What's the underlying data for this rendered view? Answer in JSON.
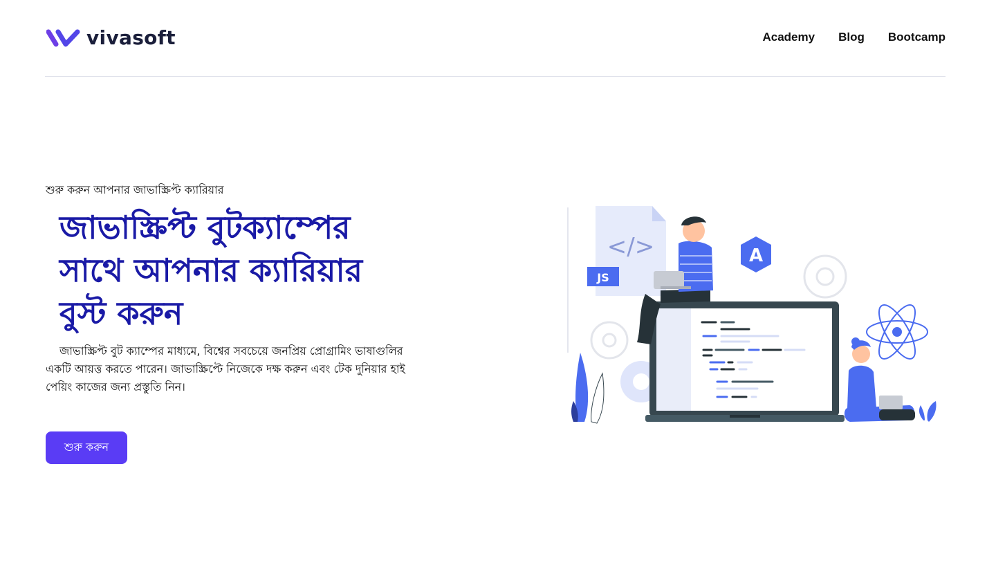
{
  "header": {
    "logo_text": "vivasoft",
    "nav": [
      {
        "label": "Academy"
      },
      {
        "label": "Blog"
      },
      {
        "label": "Bootcamp"
      }
    ]
  },
  "hero": {
    "tagline": "শুরু করুন আপনার জাভাস্ক্রিপ্ট ক্যারিয়ার",
    "title_lines": [
      "জাভাস্ক্রিপ্ট বুটক্যাম্পের",
      "সাথে আপনার ক্যারিয়ার",
      "বুস্ট করুন"
    ],
    "description": "জাভাস্ক্রিপ্ট বুট ক্যাম্পের মাধ্যমে, বিশ্বের সবচেয়ে জনপ্রিয় প্রোগ্রামিং ভাষাগুলির একটি আয়ত্ত করতে পারেন। জাভাস্ক্রিপ্টে নিজেকে দক্ষ করুন এবং টেক দুনিয়ার হাই পেয়িং কাজের জন্য প্রস্তুতি নিন।",
    "cta_label": "শুরু করুন"
  },
  "illustration": {
    "file_badge": "JS",
    "angular_badge": "A",
    "code_glyph": "</>",
    "icons": [
      "code-file-icon",
      "angular-logo-icon",
      "react-atom-icon",
      "gear-icon",
      "laptop-icon"
    ]
  },
  "colors": {
    "brand": "#5a3cf5",
    "headline": "#1a1aa6",
    "illustration_accent": "#4b6cf0"
  }
}
